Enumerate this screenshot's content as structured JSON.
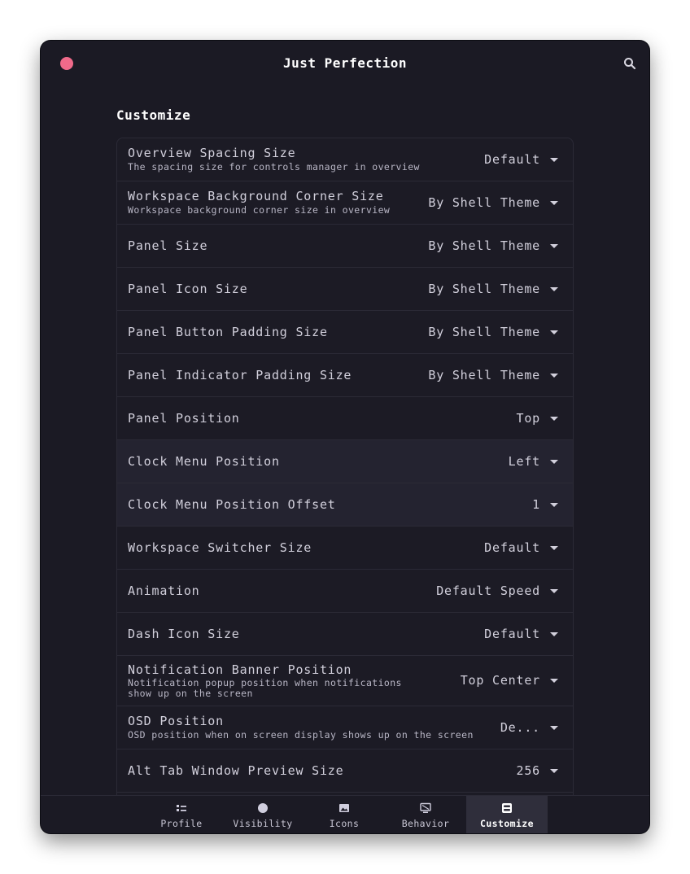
{
  "window": {
    "title": "Just Perfection"
  },
  "section": {
    "title": "Customize"
  },
  "rows": [
    {
      "label": "Overview Spacing Size",
      "subtitle": "The spacing size for controls manager in overview",
      "value": "Default"
    },
    {
      "label": "Workspace Background Corner Size",
      "subtitle": "Workspace background corner size in overview",
      "value": "By Shell Theme"
    },
    {
      "label": "Panel Size",
      "value": "By Shell Theme"
    },
    {
      "label": "Panel Icon Size",
      "value": "By Shell Theme"
    },
    {
      "label": "Panel Button Padding Size",
      "value": "By Shell Theme"
    },
    {
      "label": "Panel Indicator Padding Size",
      "value": "By Shell Theme"
    },
    {
      "label": "Panel Position",
      "value": "Top"
    },
    {
      "label": "Clock Menu Position",
      "value": "Left"
    },
    {
      "label": "Clock Menu Position Offset",
      "value": "1"
    },
    {
      "label": "Workspace Switcher Size",
      "value": "Default"
    },
    {
      "label": "Animation",
      "value": "Default Speed"
    },
    {
      "label": "Dash Icon Size",
      "value": "Default"
    },
    {
      "label": "Notification Banner Position",
      "subtitle": "Notification popup position when notifications",
      "subtitle2": "show up on the screen",
      "value": "Top Center"
    },
    {
      "label": "OSD Position",
      "subtitle": "OSD position when on screen display shows up on the screen",
      "value": "De..."
    },
    {
      "label": "Alt Tab Window Preview Size",
      "value": "256"
    }
  ],
  "tabs": [
    {
      "label": "Profile",
      "icon": "profile-list-icon"
    },
    {
      "label": "Visibility",
      "icon": "visibility-dot-icon"
    },
    {
      "label": "Icons",
      "icon": "image-icon"
    },
    {
      "label": "Behavior",
      "icon": "monitor-icon"
    },
    {
      "label": "Customize",
      "icon": "customize-icon"
    }
  ],
  "colors": {
    "close": "#f06a8a",
    "background": "#1b1a24",
    "active_tab": "#2f2e3b"
  }
}
